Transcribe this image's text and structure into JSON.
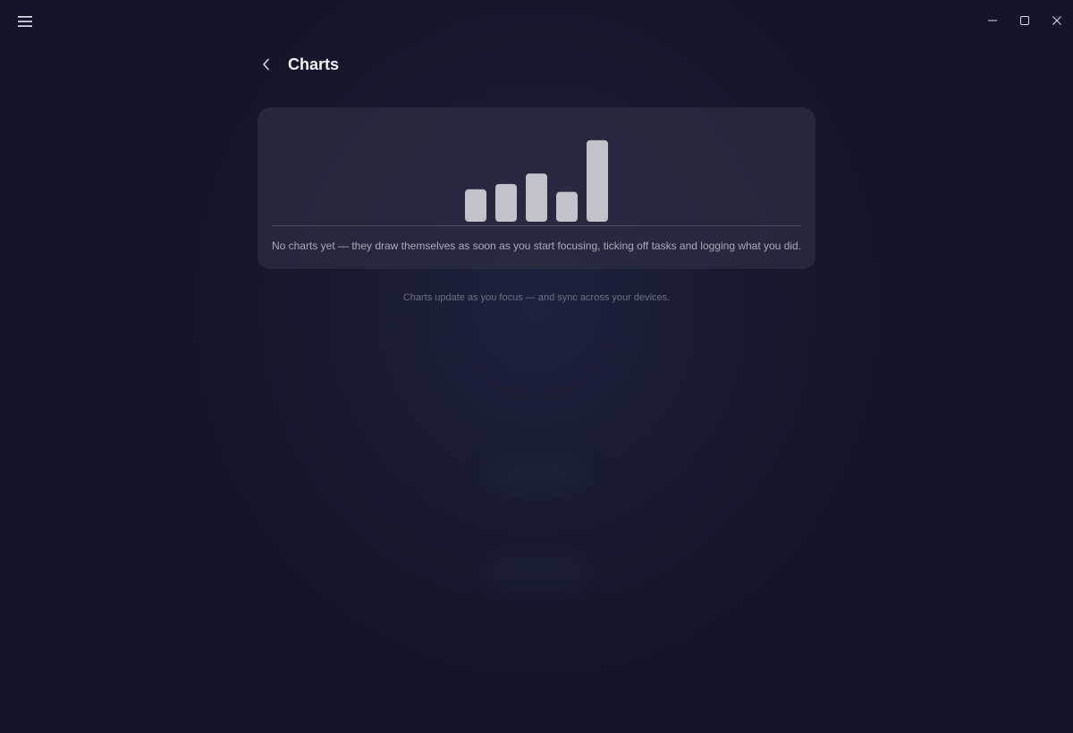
{
  "titlebar": {
    "menu_icon": "hamburger-icon",
    "controls": [
      "minimize-icon",
      "maximize-icon",
      "close-icon"
    ]
  },
  "header": {
    "back_icon": "chevron-left-icon",
    "title": "Charts"
  },
  "chart_data": {
    "type": "bar",
    "categories": [
      "",
      "",
      "",
      "",
      ""
    ],
    "values": [
      37,
      43,
      55,
      34,
      93
    ],
    "ylim": [
      0,
      100
    ],
    "title": "",
    "xlabel": "",
    "ylabel": "",
    "bar_color": "#c2c2ca",
    "axis_color": "#4a4d64",
    "grid": false,
    "legend": "none"
  },
  "card": {
    "empty_message": "No charts yet — they draw themselves as soon as you start focusing, ticking off tasks and logging what you did."
  },
  "footer": {
    "note": "Charts update as you focus — and sync across your devices."
  },
  "colors": {
    "background": "#13152a",
    "card": "#2c2e44",
    "title_text": "#f2f3f8",
    "body_text": "#a8aab8",
    "muted_text": "#6e7186"
  }
}
